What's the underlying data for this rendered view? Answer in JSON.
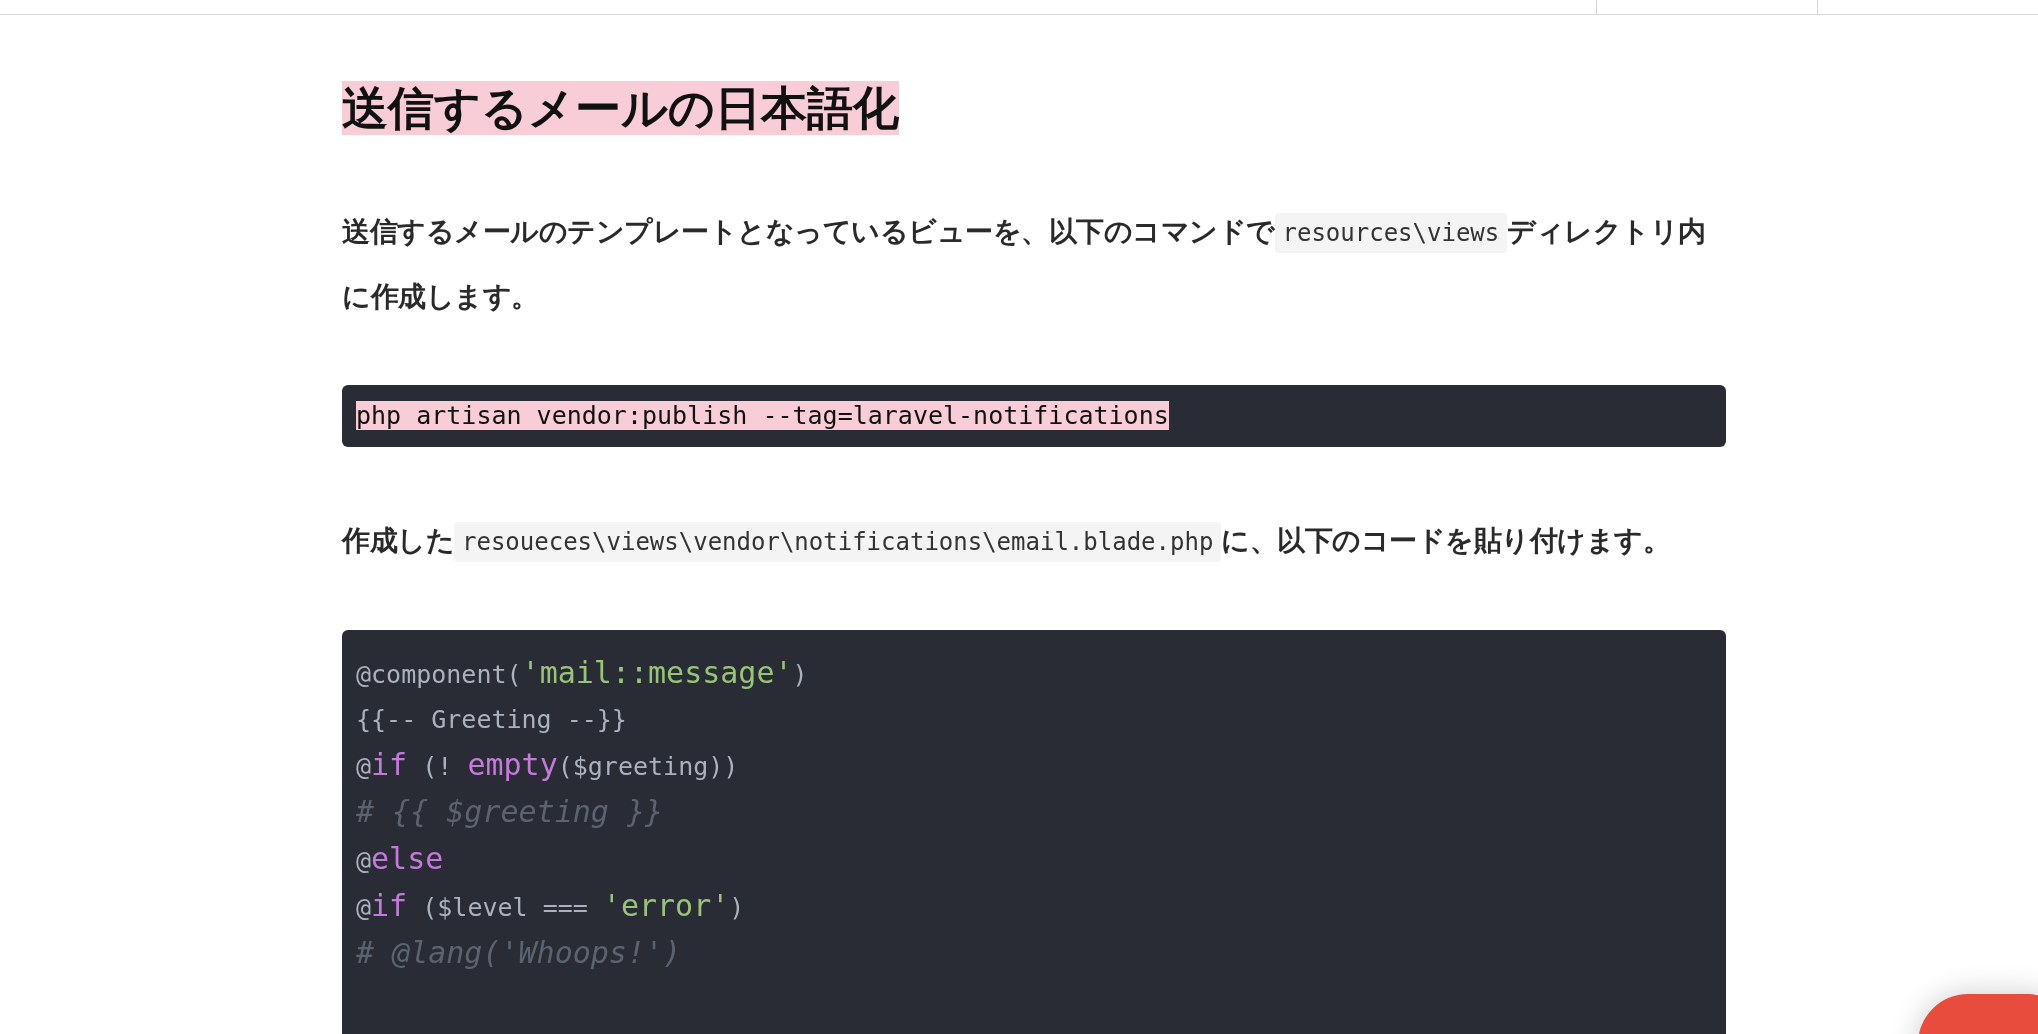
{
  "heading": "送信するメールの日本語化",
  "paragraphs_1": [
    {
      "kind": "text",
      "text": "送信するメールのテンプレートとなっているビューを、以下のコマンドで"
    },
    {
      "kind": "code",
      "text": "resources\\views"
    },
    {
      "kind": "text",
      "text": "ディレクトリ内に作成します。"
    }
  ],
  "command_block": {
    "text": "php artisan vendor:publish --tag=laravel-notifications",
    "highlighted": true
  },
  "paragraphs_2": [
    {
      "kind": "text",
      "text": "作成した"
    },
    {
      "kind": "code",
      "text": "resoueces\\views\\vendor\\notifications\\email.blade.php"
    },
    {
      "kind": "text",
      "text": "に、以下のコードを貼り付けます。"
    }
  ],
  "code_block": {
    "lines": [
      [
        {
          "kind": "plain",
          "text": "@component("
        },
        {
          "kind": "string",
          "text": "'mail::message'"
        },
        {
          "kind": "plain",
          "text": ")"
        }
      ],
      [
        {
          "kind": "plain",
          "text": "{{-- Greeting --}}"
        }
      ],
      [
        {
          "kind": "plain",
          "text": "@"
        },
        {
          "kind": "keyword",
          "text": "if"
        },
        {
          "kind": "plain",
          "text": " (! "
        },
        {
          "kind": "keyword",
          "text": "empty"
        },
        {
          "kind": "plain",
          "text": "($greeting))"
        }
      ],
      [
        {
          "kind": "comment",
          "text": "# {{ $greeting }}"
        }
      ],
      [
        {
          "kind": "plain",
          "text": "@"
        },
        {
          "kind": "keyword",
          "text": "else"
        }
      ],
      [
        {
          "kind": "plain",
          "text": "@"
        },
        {
          "kind": "keyword",
          "text": "if"
        },
        {
          "kind": "plain",
          "text": " ($level === "
        },
        {
          "kind": "string",
          "text": "'error'"
        },
        {
          "kind": "plain",
          "text": ")"
        }
      ],
      [
        {
          "kind": "comment",
          "text": "# @lang('Whoops!')"
        }
      ]
    ]
  }
}
